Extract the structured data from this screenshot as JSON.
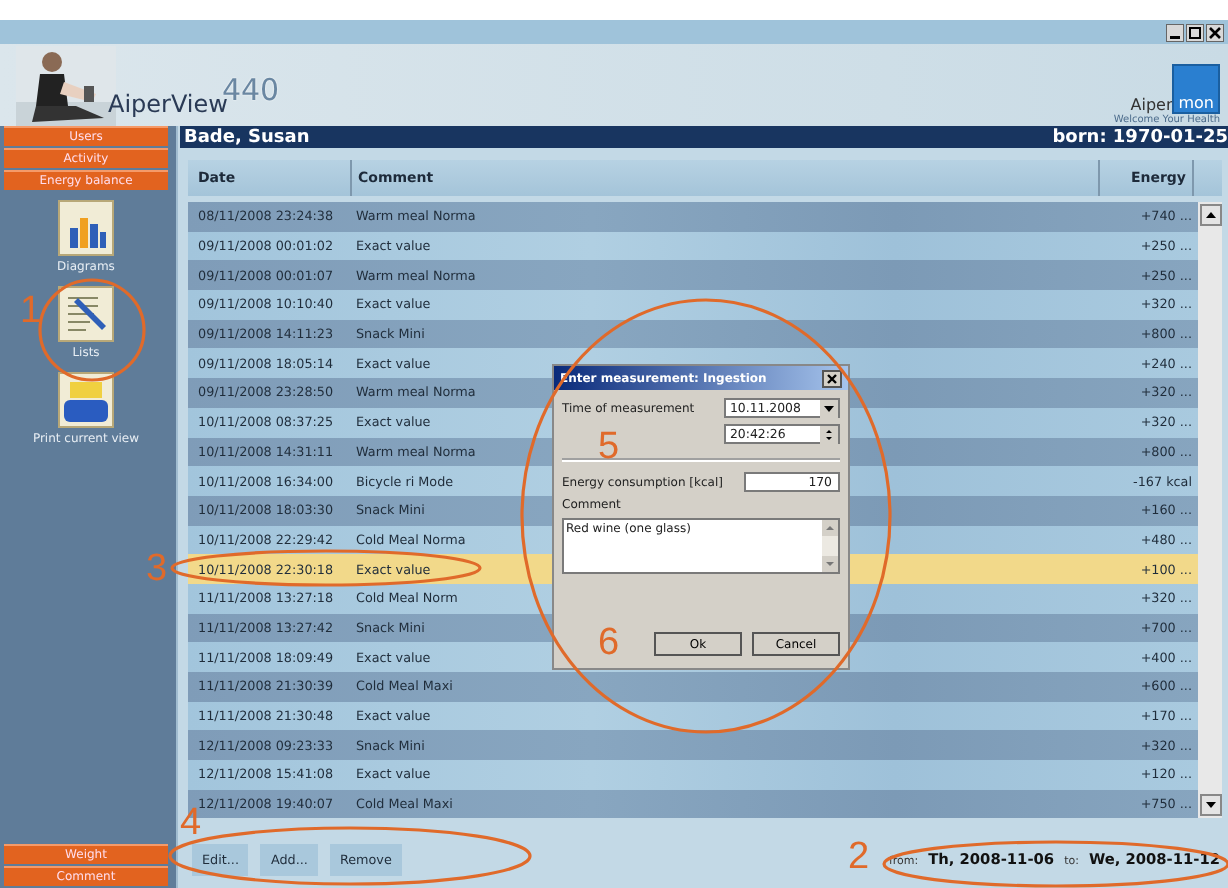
{
  "header": {
    "app_name": "AiperView",
    "app_version": "440",
    "brand_left": "Aiper",
    "brand_right": "mon",
    "tagline": "Welcome Your Health"
  },
  "sidebar": {
    "tabs": [
      {
        "label": "Users"
      },
      {
        "label": "Activity"
      },
      {
        "label": "Energy balance"
      }
    ],
    "tools": [
      {
        "kind": "chart",
        "label": "Diagrams"
      },
      {
        "kind": "list",
        "label": "Lists"
      },
      {
        "kind": "print",
        "label": "Print current view"
      }
    ],
    "bottom_tabs": [
      {
        "label": "Weight"
      },
      {
        "label": "Comment"
      }
    ]
  },
  "patient": {
    "name": "Bade, Susan",
    "born": "born: 1970-01-25"
  },
  "table": {
    "columns": [
      "Date",
      "Comment",
      "Energy"
    ],
    "rows": [
      {
        "date": "08/11/2008 23:24:38",
        "comment": "Warm meal Norma",
        "energy": "+740 ...",
        "selected": false
      },
      {
        "date": "09/11/2008 00:01:02",
        "comment": "Exact value",
        "energy": "+250 ...",
        "selected": false
      },
      {
        "date": "09/11/2008 00:01:07",
        "comment": "Warm meal Norma",
        "energy": "+250 ...",
        "selected": false
      },
      {
        "date": "09/11/2008 10:10:40",
        "comment": "Exact value",
        "energy": "+320 ...",
        "selected": false
      },
      {
        "date": "09/11/2008 14:11:23",
        "comment": "Snack Mini",
        "energy": "+800 ...",
        "selected": false
      },
      {
        "date": "09/11/2008 18:05:14",
        "comment": "Exact value",
        "energy": "+240 ...",
        "selected": false
      },
      {
        "date": "09/11/2008 23:28:50",
        "comment": "Warm meal Norma",
        "energy": "+320 ...",
        "selected": false
      },
      {
        "date": "10/11/2008 08:37:25",
        "comment": "Exact value",
        "energy": "+320 ...",
        "selected": false
      },
      {
        "date": "10/11/2008 14:31:11",
        "comment": "Warm meal Norma",
        "energy": "+800 ...",
        "selected": false
      },
      {
        "date": "10/11/2008 16:34:00",
        "comment": "Bicycle ri Mode",
        "energy": "-167 kcal",
        "selected": false
      },
      {
        "date": "10/11/2008 18:03:30",
        "comment": "Snack Mini",
        "energy": "+160 ...",
        "selected": false
      },
      {
        "date": "10/11/2008 22:29:42",
        "comment": "Cold Meal Norma",
        "energy": "+480 ...",
        "selected": false
      },
      {
        "date": "10/11/2008 22:30:18",
        "comment": "Exact value",
        "energy": "+100 ...",
        "selected": true
      },
      {
        "date": "11/11/2008 13:27:18",
        "comment": "Cold Meal Norm",
        "energy": "+320 ...",
        "selected": false
      },
      {
        "date": "11/11/2008 13:27:42",
        "comment": "Snack Mini",
        "energy": "+700 ...",
        "selected": false
      },
      {
        "date": "11/11/2008 18:09:49",
        "comment": "Exact value",
        "energy": "+400 ...",
        "selected": false
      },
      {
        "date": "11/11/2008 21:30:39",
        "comment": "Cold Meal Maxi",
        "energy": "+600 ...",
        "selected": false
      },
      {
        "date": "11/11/2008 21:30:48",
        "comment": "Exact value",
        "energy": "+170 ...",
        "selected": false
      },
      {
        "date": "12/11/2008 09:23:33",
        "comment": "Snack Mini",
        "energy": "+320 ...",
        "selected": false
      },
      {
        "date": "12/11/2008 15:41:08",
        "comment": "Exact value",
        "energy": "+120 ...",
        "selected": false
      },
      {
        "date": "12/11/2008 19:40:07",
        "comment": "Cold Meal Maxi",
        "energy": "+750 ...",
        "selected": false
      }
    ]
  },
  "actions": [
    "Edit...",
    "Add...",
    "Remove"
  ],
  "range": {
    "from_label": "from:",
    "from": "Th, 2008-11-06",
    "to_label": "to:",
    "to": "We, 2008-11-12"
  },
  "dialog": {
    "title": "Enter measurement: Ingestion",
    "time_label": "Time of measurement",
    "date": "10.11.2008",
    "time": "20:42:26",
    "energy_label": "Energy consumption [kcal]",
    "energy": "170",
    "comment_label": "Comment",
    "comment": "Red wine (one glass)",
    "buttons": [
      "Ok",
      "Cancel"
    ]
  },
  "annotations": [
    "1",
    "2",
    "3",
    "4",
    "5",
    "6"
  ]
}
